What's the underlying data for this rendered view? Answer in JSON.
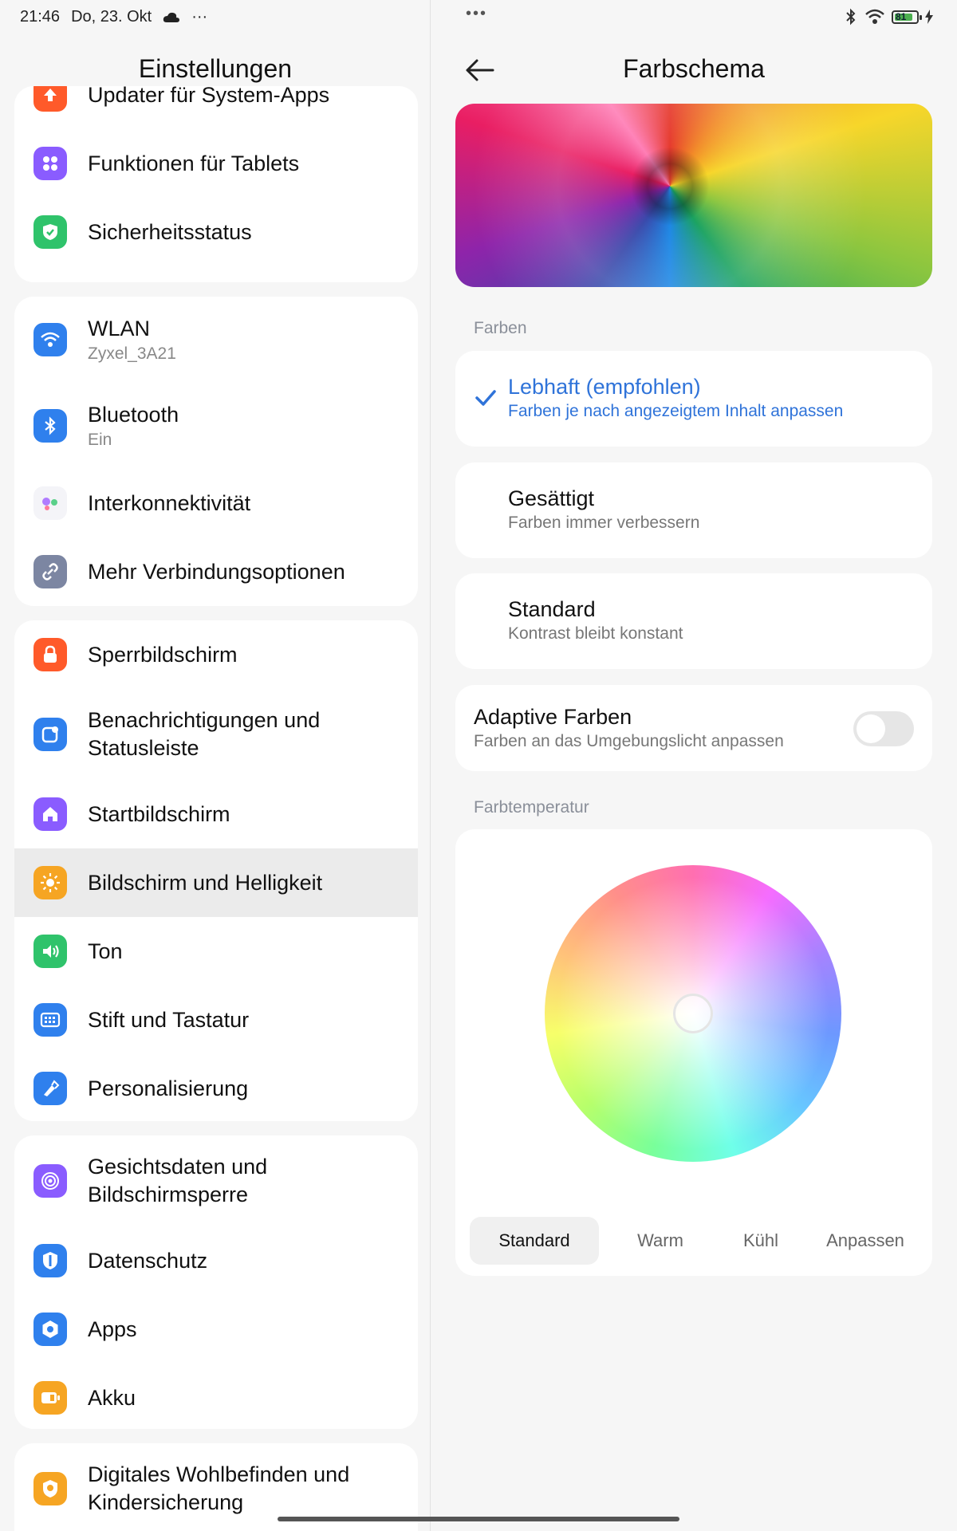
{
  "statusbar": {
    "time": "21:46",
    "date": "Do, 23. Okt",
    "more_left": "···",
    "more_mid": "•••",
    "battery": "81"
  },
  "left": {
    "title": "Einstellungen",
    "groups": [
      {
        "items": [
          {
            "label": "Updater für System-Apps",
            "icon": "upload-arrow-icon",
            "color": "#ff5a2a"
          },
          {
            "label": "Funktionen für Tablets",
            "icon": "tablet-grid-icon",
            "color": "#8a5cff"
          },
          {
            "label": "Sicherheitsstatus",
            "icon": "shield-check-icon",
            "color": "#2fc36b"
          }
        ]
      },
      {
        "items": [
          {
            "label": "WLAN",
            "sub": "Zyxel_3A21",
            "icon": "wifi-icon",
            "color": "#2f80ed"
          },
          {
            "label": "Bluetooth",
            "sub": "Ein",
            "icon": "bluetooth-icon",
            "color": "#2f80ed"
          },
          {
            "label": "Interkonnektivität",
            "icon": "interconnect-icon",
            "color": "#ffffff"
          },
          {
            "label": "Mehr Verbindungsoptionen",
            "icon": "link-icon",
            "color": "#7c86a2"
          }
        ]
      },
      {
        "items": [
          {
            "label": "Sperrbildschirm",
            "icon": "lock-icon",
            "color": "#ff5a2a"
          },
          {
            "label": "Benachrichtigungen und",
            "label2": "Statusleiste",
            "icon": "notification-icon",
            "color": "#2f80ed"
          },
          {
            "label": "Startbildschirm",
            "icon": "home-icon",
            "color": "#8a5cff"
          },
          {
            "label": "Bildschirm und Helligkeit",
            "icon": "sun-icon",
            "color": "#f6a523"
          },
          {
            "label": "Ton",
            "icon": "speaker-icon",
            "color": "#2fc36b"
          },
          {
            "label": "Stift und Tastatur",
            "icon": "keyboard-icon",
            "color": "#2f80ed"
          },
          {
            "label": "Personalisierung",
            "icon": "brush-icon",
            "color": "#2f80ed"
          }
        ]
      },
      {
        "items": [
          {
            "label": "Gesichtsdaten und",
            "label2": "Bildschirmsperre",
            "icon": "fingerprint-icon",
            "color": "#8a5cff"
          },
          {
            "label": "Datenschutz",
            "icon": "privacy-icon",
            "color": "#2f80ed"
          },
          {
            "label": "Apps",
            "icon": "apps-gear-icon",
            "color": "#2f80ed"
          },
          {
            "label": "Akku",
            "icon": "battery-icon",
            "color": "#f6a523"
          }
        ]
      },
      {
        "items": [
          {
            "label": "Digitales Wohlbefinden und",
            "label2": "Kindersicherung",
            "icon": "wellbeing-icon",
            "color": "#f6a523"
          }
        ]
      }
    ]
  },
  "right": {
    "title": "Farbschema",
    "section_colors": "Farben",
    "options": [
      {
        "title": "Lebhaft (empfohlen)",
        "sub": "Farben je nach angezeigtem Inhalt anpassen"
      },
      {
        "title": "Gesättigt",
        "sub": "Farben immer verbessern"
      },
      {
        "title": "Standard",
        "sub": "Kontrast bleibt konstant"
      }
    ],
    "adaptive": {
      "title": "Adaptive Farben",
      "sub": "Farben an das Umgebungslicht anpassen",
      "enabled": false
    },
    "section_temp": "Farbtemperatur",
    "segments": [
      "Standard",
      "Warm",
      "Kühl",
      "Anpassen"
    ]
  }
}
